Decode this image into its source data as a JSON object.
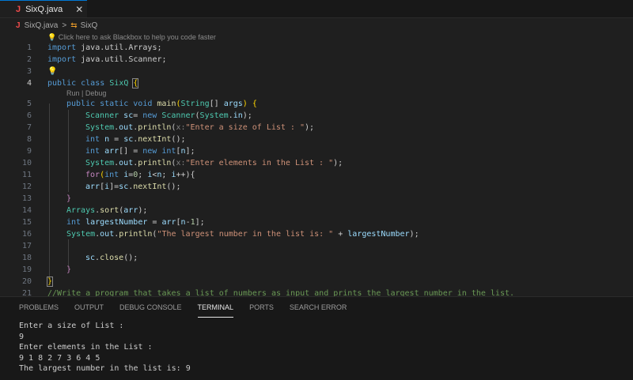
{
  "tab": {
    "icon": "J",
    "label": "SixQ.java",
    "close": "✕"
  },
  "breadcrumb": {
    "icon": "J",
    "file": "SixQ.java",
    "sep": ">",
    "class_icon": "⇆",
    "class": "SixQ"
  },
  "hints": {
    "blackbox": "Click here to ask Blackbox to help you code faster",
    "runDebug": "Run | Debug"
  },
  "code": {
    "l1": "import java.util.Arrays;",
    "l2": "import java.util.Scanner;",
    "l4a": "public class ",
    "l4b": "SixQ ",
    "l4c": "{",
    "l5": [
      "public static void ",
      "main",
      "(",
      "String",
      "[] ",
      "args",
      ") {"
    ],
    "l6": [
      "Scanner ",
      "sc",
      "= ",
      "new ",
      "Scanner",
      "(",
      "System",
      ".",
      "in",
      ");"
    ],
    "l7": [
      "System",
      ".",
      "out",
      ".",
      "println",
      "(",
      "x:",
      "\"Enter a size of List : \"",
      ");"
    ],
    "l8": [
      "int ",
      "n",
      " = ",
      "sc",
      ".",
      "nextInt",
      "();"
    ],
    "l9": [
      "int ",
      "arr",
      "[] = ",
      "new ",
      "int",
      "[",
      "n",
      "];"
    ],
    "l10": [
      "System",
      ".",
      "out",
      ".",
      "println",
      "(",
      "x:",
      "\"Enter elements in the List : \"",
      ");"
    ],
    "l11": [
      "for",
      "(",
      "int ",
      "i",
      "=",
      "0",
      "; ",
      "i",
      "<",
      "n",
      "; ",
      "i",
      "++){"
    ],
    "l12": [
      "arr",
      "[",
      "i",
      "]=",
      "sc",
      ".",
      "nextInt",
      "();"
    ],
    "l13": "}",
    "l14": [
      "Arrays",
      ".",
      "sort",
      "(",
      "arr",
      ");"
    ],
    "l15": [
      "int ",
      "largestNumber",
      " = ",
      "arr",
      "[",
      "n",
      "-",
      "1",
      "];"
    ],
    "l16": [
      "System",
      ".",
      "out",
      ".",
      "println",
      "(",
      "\"The largest number in the list is: \"",
      " + ",
      "largestNumber",
      ");"
    ],
    "l18": [
      "sc",
      ".",
      "close",
      "();"
    ],
    "l19": "}",
    "l20": "}",
    "l21": "//Write a program that takes a list of numbers as input and prints the largest number in the list."
  },
  "lineNumbers": [
    "1",
    "2",
    "3",
    "4",
    "5",
    "6",
    "7",
    "8",
    "9",
    "10",
    "11",
    "12",
    "13",
    "14",
    "15",
    "16",
    "17",
    "18",
    "19",
    "20",
    "21"
  ],
  "panel": {
    "tabs": [
      "PROBLEMS",
      "OUTPUT",
      "DEBUG CONSOLE",
      "TERMINAL",
      "PORTS",
      "SEARCH ERROR"
    ],
    "activeTab": "TERMINAL"
  },
  "terminal": [
    "Enter a size of List :",
    "9",
    "Enter elements in the List :",
    "9 1 8 2 7 3 6 4 5",
    "The largest number in the list is: 9"
  ],
  "colors": {
    "keyword": "#569cd6",
    "type": "#4ec9b0",
    "string": "#ce9178",
    "comment": "#6a9955",
    "accent": "#0078d4"
  }
}
